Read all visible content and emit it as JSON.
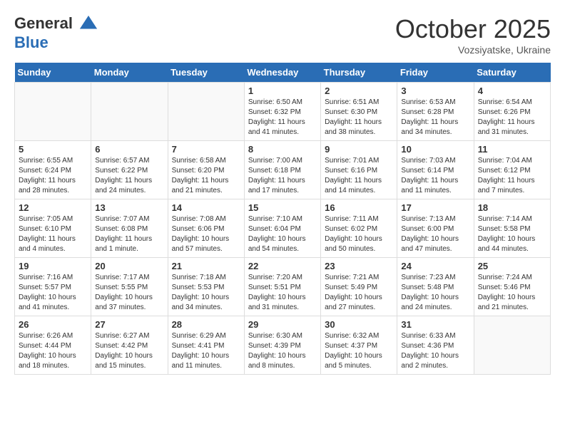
{
  "header": {
    "logo_line1": "General",
    "logo_line2": "Blue",
    "month": "October 2025",
    "location": "Vozsiyatske, Ukraine"
  },
  "days_of_week": [
    "Sunday",
    "Monday",
    "Tuesday",
    "Wednesday",
    "Thursday",
    "Friday",
    "Saturday"
  ],
  "weeks": [
    [
      {
        "day": "",
        "info": "",
        "empty": true
      },
      {
        "day": "",
        "info": "",
        "empty": true
      },
      {
        "day": "",
        "info": "",
        "empty": true
      },
      {
        "day": "1",
        "info": "Sunrise: 6:50 AM\nSunset: 6:32 PM\nDaylight: 11 hours\nand 41 minutes."
      },
      {
        "day": "2",
        "info": "Sunrise: 6:51 AM\nSunset: 6:30 PM\nDaylight: 11 hours\nand 38 minutes."
      },
      {
        "day": "3",
        "info": "Sunrise: 6:53 AM\nSunset: 6:28 PM\nDaylight: 11 hours\nand 34 minutes."
      },
      {
        "day": "4",
        "info": "Sunrise: 6:54 AM\nSunset: 6:26 PM\nDaylight: 11 hours\nand 31 minutes."
      }
    ],
    [
      {
        "day": "5",
        "info": "Sunrise: 6:55 AM\nSunset: 6:24 PM\nDaylight: 11 hours\nand 28 minutes."
      },
      {
        "day": "6",
        "info": "Sunrise: 6:57 AM\nSunset: 6:22 PM\nDaylight: 11 hours\nand 24 minutes."
      },
      {
        "day": "7",
        "info": "Sunrise: 6:58 AM\nSunset: 6:20 PM\nDaylight: 11 hours\nand 21 minutes."
      },
      {
        "day": "8",
        "info": "Sunrise: 7:00 AM\nSunset: 6:18 PM\nDaylight: 11 hours\nand 17 minutes."
      },
      {
        "day": "9",
        "info": "Sunrise: 7:01 AM\nSunset: 6:16 PM\nDaylight: 11 hours\nand 14 minutes."
      },
      {
        "day": "10",
        "info": "Sunrise: 7:03 AM\nSunset: 6:14 PM\nDaylight: 11 hours\nand 11 minutes."
      },
      {
        "day": "11",
        "info": "Sunrise: 7:04 AM\nSunset: 6:12 PM\nDaylight: 11 hours\nand 7 minutes."
      }
    ],
    [
      {
        "day": "12",
        "info": "Sunrise: 7:05 AM\nSunset: 6:10 PM\nDaylight: 11 hours\nand 4 minutes."
      },
      {
        "day": "13",
        "info": "Sunrise: 7:07 AM\nSunset: 6:08 PM\nDaylight: 11 hours\nand 1 minute."
      },
      {
        "day": "14",
        "info": "Sunrise: 7:08 AM\nSunset: 6:06 PM\nDaylight: 10 hours\nand 57 minutes."
      },
      {
        "day": "15",
        "info": "Sunrise: 7:10 AM\nSunset: 6:04 PM\nDaylight: 10 hours\nand 54 minutes."
      },
      {
        "day": "16",
        "info": "Sunrise: 7:11 AM\nSunset: 6:02 PM\nDaylight: 10 hours\nand 50 minutes."
      },
      {
        "day": "17",
        "info": "Sunrise: 7:13 AM\nSunset: 6:00 PM\nDaylight: 10 hours\nand 47 minutes."
      },
      {
        "day": "18",
        "info": "Sunrise: 7:14 AM\nSunset: 5:58 PM\nDaylight: 10 hours\nand 44 minutes."
      }
    ],
    [
      {
        "day": "19",
        "info": "Sunrise: 7:16 AM\nSunset: 5:57 PM\nDaylight: 10 hours\nand 41 minutes."
      },
      {
        "day": "20",
        "info": "Sunrise: 7:17 AM\nSunset: 5:55 PM\nDaylight: 10 hours\nand 37 minutes."
      },
      {
        "day": "21",
        "info": "Sunrise: 7:18 AM\nSunset: 5:53 PM\nDaylight: 10 hours\nand 34 minutes."
      },
      {
        "day": "22",
        "info": "Sunrise: 7:20 AM\nSunset: 5:51 PM\nDaylight: 10 hours\nand 31 minutes."
      },
      {
        "day": "23",
        "info": "Sunrise: 7:21 AM\nSunset: 5:49 PM\nDaylight: 10 hours\nand 27 minutes."
      },
      {
        "day": "24",
        "info": "Sunrise: 7:23 AM\nSunset: 5:48 PM\nDaylight: 10 hours\nand 24 minutes."
      },
      {
        "day": "25",
        "info": "Sunrise: 7:24 AM\nSunset: 5:46 PM\nDaylight: 10 hours\nand 21 minutes."
      }
    ],
    [
      {
        "day": "26",
        "info": "Sunrise: 6:26 AM\nSunset: 4:44 PM\nDaylight: 10 hours\nand 18 minutes."
      },
      {
        "day": "27",
        "info": "Sunrise: 6:27 AM\nSunset: 4:42 PM\nDaylight: 10 hours\nand 15 minutes."
      },
      {
        "day": "28",
        "info": "Sunrise: 6:29 AM\nSunset: 4:41 PM\nDaylight: 10 hours\nand 11 minutes."
      },
      {
        "day": "29",
        "info": "Sunrise: 6:30 AM\nSunset: 4:39 PM\nDaylight: 10 hours\nand 8 minutes."
      },
      {
        "day": "30",
        "info": "Sunrise: 6:32 AM\nSunset: 4:37 PM\nDaylight: 10 hours\nand 5 minutes."
      },
      {
        "day": "31",
        "info": "Sunrise: 6:33 AM\nSunset: 4:36 PM\nDaylight: 10 hours\nand 2 minutes."
      },
      {
        "day": "",
        "info": "",
        "empty": true
      }
    ]
  ]
}
